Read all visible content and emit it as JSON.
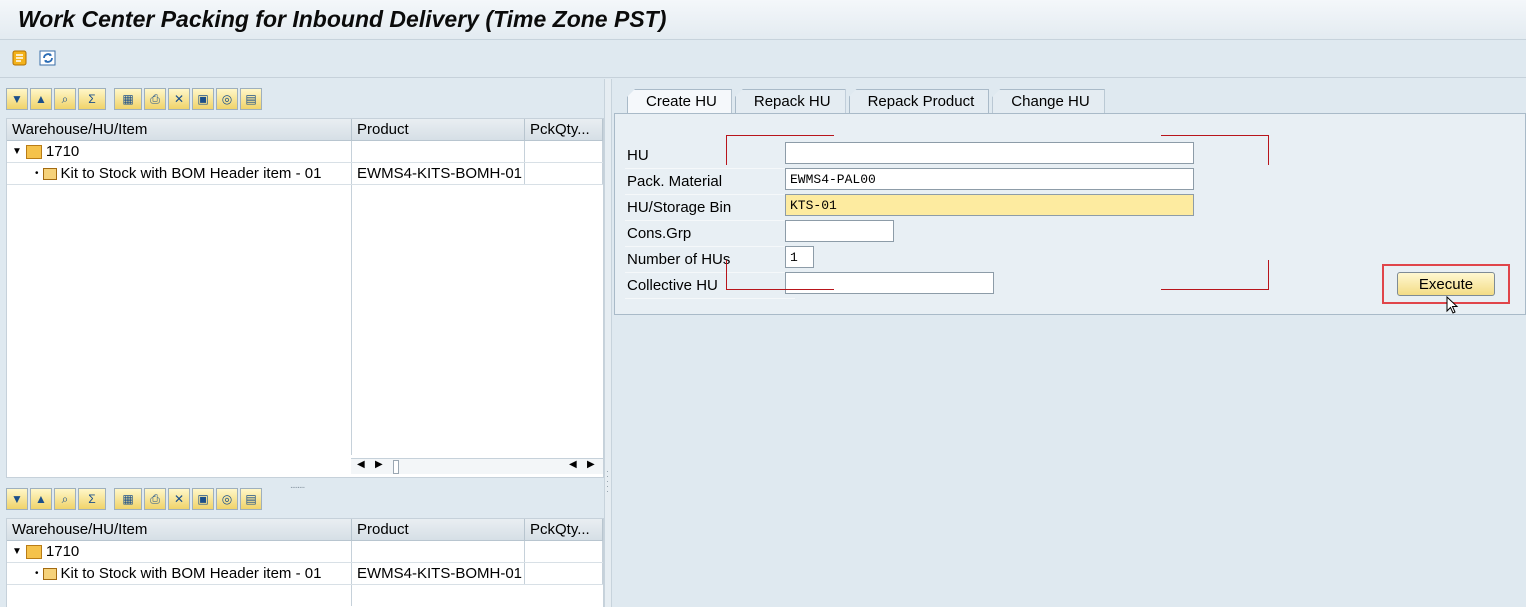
{
  "title": "Work Center Packing for Inbound Delivery (Time Zone PST)",
  "app_toolbar": {
    "icons": [
      "scroll-icon",
      "refresh-icon"
    ]
  },
  "upper_grid": {
    "columns": [
      "Warehouse/HU/Item",
      "Product",
      "PckQty..."
    ],
    "rows": [
      {
        "label": "1710",
        "product": "",
        "qty": ""
      },
      {
        "label": "Kit to Stock with BOM Header item - 01",
        "product": "EWMS4-KITS-BOMH-01",
        "qty": ""
      }
    ]
  },
  "lower_grid": {
    "columns": [
      "Warehouse/HU/Item",
      "Product",
      "PckQty..."
    ],
    "rows": [
      {
        "label": "1710",
        "product": "",
        "qty": ""
      },
      {
        "label": "Kit to Stock with BOM Header item - 01",
        "product": "EWMS4-KITS-BOMH-01",
        "qty": ""
      }
    ]
  },
  "tabs": [
    "Create HU",
    "Repack HU",
    "Repack Product",
    "Change HU"
  ],
  "form": {
    "hu_label": "HU",
    "hu_value": "",
    "pack_material_label": "Pack. Material",
    "pack_material_value": "EWMS4-PAL00",
    "storage_bin_label": "HU/Storage Bin",
    "storage_bin_value": "KTS-01",
    "cons_grp_label": "Cons.Grp",
    "cons_grp_value": "",
    "num_hus_label": "Number of HUs",
    "num_hus_value": "1",
    "collective_hu_label": "Collective HU",
    "collective_hu_value": ""
  },
  "execute_label": "Execute",
  "colors": {
    "highlight": "#e0454a",
    "field_yellow": "#fdeba0"
  }
}
